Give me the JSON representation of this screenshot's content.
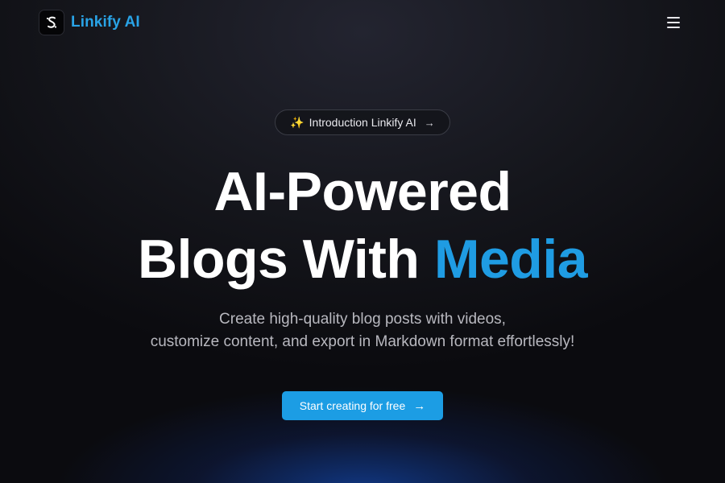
{
  "header": {
    "brand": "Linkify AI",
    "logo_icon": "linkify-logo-icon",
    "menu_icon": "hamburger-menu-icon"
  },
  "hero": {
    "badge": {
      "icon": "sparkles-icon",
      "icon_glyph": "✨",
      "label": "Introduction Linkify AI",
      "arrow_glyph": "→"
    },
    "headline": {
      "line1": "AI-Powered",
      "line2_prefix": "Blogs With ",
      "line2_accent": "Media"
    },
    "subtitle": {
      "line1": "Create high-quality blog posts with videos,",
      "line2": "customize content, and export in Markdown format effortlessly!"
    },
    "cta": {
      "label": "Start creating for free",
      "arrow_glyph": "→"
    }
  },
  "colors": {
    "accent": "#1f9ce3",
    "background": "#0b0b0f",
    "cta_background": "#1c9de4"
  }
}
